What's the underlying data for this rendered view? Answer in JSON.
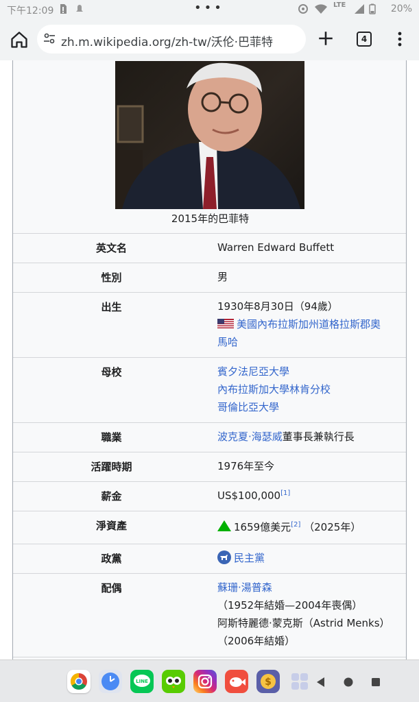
{
  "status_bar": {
    "time": "下午12:09",
    "battery": "20%",
    "network": "LTE"
  },
  "browser": {
    "url": "zh.m.wikipedia.org/zh-tw/沃伦·巴菲特",
    "tab_count": "4"
  },
  "infobox": {
    "image_caption": "2015年的巴菲特",
    "rows": [
      {
        "label": "英文名",
        "value": "Warren Edward Buffett"
      },
      {
        "label": "性別",
        "value": "男"
      },
      {
        "label": "出生",
        "date": "1930年8月30日（94歲）",
        "place": "美國內布拉斯加州道格拉斯郡奧馬哈",
        "place_line1": "美國內布拉斯加州道格拉斯郡奧",
        "place_line2": "馬哈"
      },
      {
        "label": "母校",
        "values": [
          "賓夕法尼亞大學",
          "內布拉斯加大學林肯分校",
          "哥倫比亞大學"
        ]
      },
      {
        "label": "職業",
        "link": "波克夏·海瑟威",
        "text": "董事長兼執行長"
      },
      {
        "label": "活躍時期",
        "value": "1976年至今"
      },
      {
        "label": "薪金",
        "value": "US$100,000",
        "ref": "[1]"
      },
      {
        "label": "淨資產",
        "value": "1659億美元",
        "ref": "[2]",
        "year": "（2025年）"
      },
      {
        "label": "政黨",
        "value": "民主黨"
      },
      {
        "label": "配偶",
        "spouse1": "蘇珊·湯普森",
        "spouse1_dates": "（1952年結婚—2004年喪偶）",
        "spouse2": "阿斯特麗德·蒙克斯（Astrid Menks）",
        "spouse2_dates": "（2006年結婚）"
      }
    ]
  },
  "dock": {
    "apps": [
      "chrome-icon",
      "clock-icon",
      "line-icon",
      "duolingo-icon",
      "instagram-icon",
      "fish-app-icon",
      "coin-app-icon",
      "app-drawer-icon"
    ]
  },
  "colors": {
    "link": "#3366cc",
    "up_arrow": "#00b000",
    "infobox_bg": "#f8f9fa"
  }
}
